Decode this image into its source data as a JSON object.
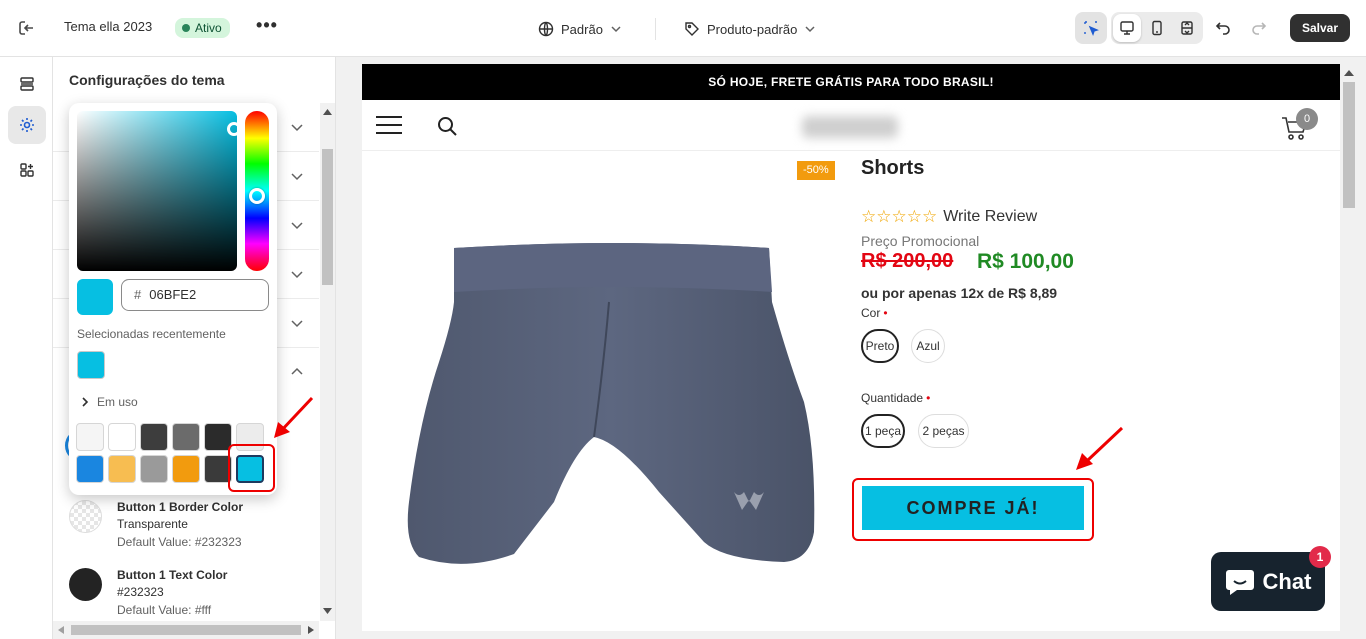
{
  "topbar": {
    "theme_name": "Tema ella 2023",
    "status": "Ativo",
    "more": "•••",
    "locale_selector": "Padrão",
    "template_selector": "Produto-padrão",
    "save_label": "Salvar"
  },
  "panel": {
    "title": "Configurações do tema",
    "settings": [
      {
        "label": "Button 1 Border Color",
        "value": "Transparente",
        "default": "Default Value: #232323"
      },
      {
        "label": "Button 1 Text Color",
        "value": "#232323",
        "default": "Default Value: #fff"
      }
    ]
  },
  "picker": {
    "hex_prefix": "#",
    "hex_value": "06BFE2",
    "recent_label": "Selecionadas recentemente",
    "in_use_label": "Em uso",
    "palette": [
      "#f5f5f5",
      "#ffffff",
      "#3d3d3d",
      "#6b6b6b",
      "#2b2b2b",
      "#ececec",
      "#1a86e0",
      "#f7bd51",
      "#9a9a9a",
      "#f29b0e",
      "#3a3a3a",
      "#06bfe2"
    ]
  },
  "store": {
    "promo_bar": "SÓ HOJE, FRETE GRÁTIS PARA TODO BRASIL!",
    "cart_count": "0",
    "discount_badge": "-50%",
    "product_title": "Shorts",
    "stars": "☆☆☆☆☆",
    "write_review": "Write Review",
    "promo_label": "Preço Promocional",
    "old_price": "R$ 200,00",
    "new_price": "R$ 100,00",
    "installments": "ou por apenas 12x de R$ 8,89",
    "color_label": "Cor",
    "color_options": [
      "Preto",
      "Azul"
    ],
    "qty_label": "Quantidade",
    "qty_options": [
      "1 peça",
      "2 peças"
    ],
    "buy_button": "COMPRE JÁ!"
  },
  "chat": {
    "label": "Chat",
    "badge": "1"
  },
  "colors": {
    "accent": "#06bfe2",
    "primary_dark": "#303030",
    "annotation_red": "#e00000"
  }
}
